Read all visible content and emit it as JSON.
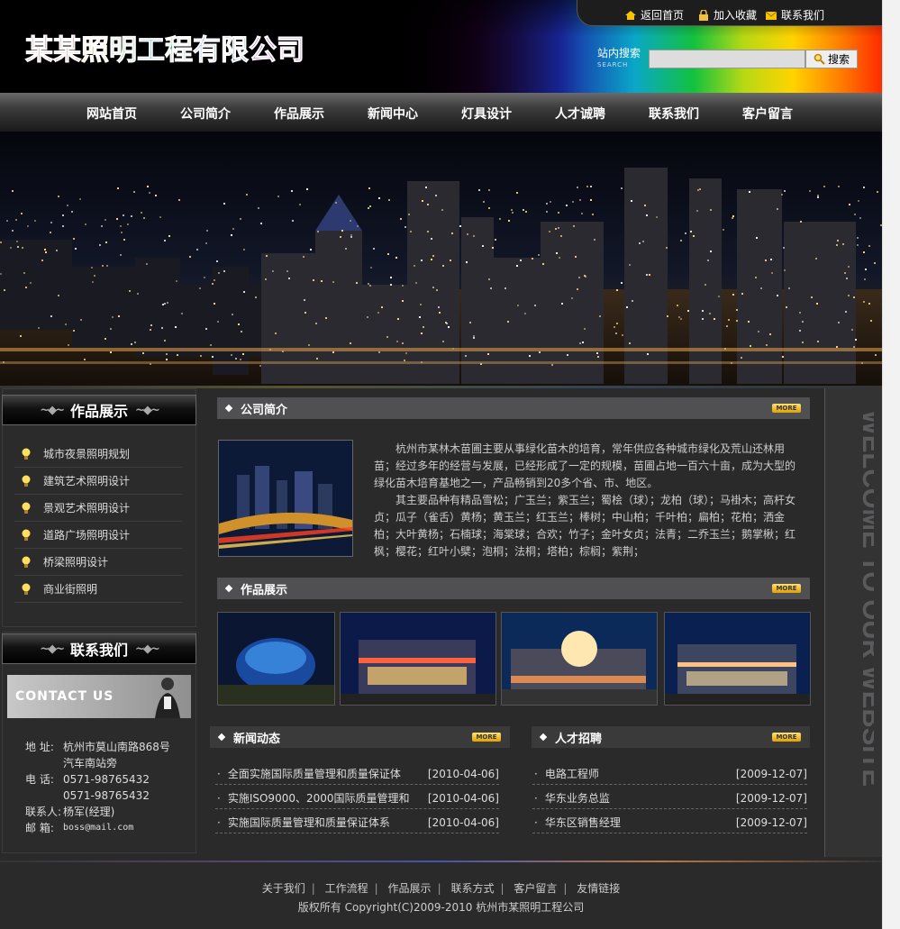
{
  "header": {
    "logo_chars": [
      {
        "c": "某",
        "color": "#e8262b"
      },
      {
        "c": "某",
        "color": "#e8262b"
      },
      {
        "c": "照",
        "color": "#ffcc00"
      },
      {
        "c": "明",
        "color": "#2bb04a"
      },
      {
        "c": "工",
        "color": "#29a9e0"
      },
      {
        "c": "程",
        "color": "#2bb04a"
      },
      {
        "c": "有",
        "color": "#1f4fd8"
      },
      {
        "c": "限",
        "color": "#1f4fd8"
      },
      {
        "c": "公",
        "color": "#a11fd8"
      },
      {
        "c": "司",
        "color": "#a11fd8"
      }
    ],
    "top_links": [
      "返回首页",
      "加入收藏",
      "联系我们"
    ],
    "search_label": "站内搜索",
    "search_label_en": "SEARCH",
    "search_value": "",
    "search_button": "搜索"
  },
  "nav": [
    "网站首页",
    "公司简介",
    "作品展示",
    "新闻中心",
    "灯具设计",
    "人才诚聘",
    "联系我们",
    "客户留言"
  ],
  "left": {
    "works_title": "作品展示",
    "works_items": [
      "城市夜景照明规划",
      "建筑艺术照明设计",
      "景观艺术照明设计",
      "道路广场照明设计",
      "桥梁照明设计",
      "商业街照明"
    ],
    "contact_title": "联系我们",
    "contact_banner": "CONTACT US",
    "contact": [
      {
        "k": "地 址:",
        "v": "杭州市莫山南路868号"
      },
      {
        "k": "",
        "v": "汽车南站旁"
      },
      {
        "k": "电 话:",
        "v": "0571-98765432"
      },
      {
        "k": "",
        "v": "0571-98765432"
      },
      {
        "k": "联系人:",
        "v": "杨军(经理)"
      },
      {
        "k": "邮 箱:",
        "v": "boss@mail.com"
      }
    ]
  },
  "center": {
    "intro_title": "公司简介",
    "more": "MORE",
    "intro_p1": "杭州市某林木苗圃主要从事绿化苗木的培育，常年供应各种城市绿化及荒山还林用苗；经过多年的经营与发展，已经形成了一定的规模，苗圃占地一百六十亩，成为大型的绿化苗木培育基地之一，产品畅销到20多个省、市、地区。",
    "intro_p2": "其主要品种有精品雪松；广玉兰；紫玉兰；蜀桧（球）；龙柏（球）；马褂木；高杆女贞；瓜子（雀舌）黄杨；黄玉兰；红玉兰；棒树；中山柏；千叶柏；扁柏；花柏；洒金柏；大叶黄杨；石楠球；海棠球；合欢；竹子；金叶女贞；法青；二乔玉兰；鹅掌楸；红枫；樱花；红叶小檗；泡桐；法桐；塔柏；棕榈；紫荆；",
    "works_title": "作品展示",
    "news_title": "新闻动态",
    "news": [
      {
        "t": "全面实施国际质量管理和质量保证体",
        "d": "[2010-04-06]"
      },
      {
        "t": "实施ISO9000、2000国际质量管理和",
        "d": "[2010-04-06]"
      },
      {
        "t": "实施国际质量管理和质量保证体系",
        "d": "[2010-04-06]"
      }
    ],
    "jobs_title": "人才招聘",
    "jobs": [
      {
        "t": "电路工程师",
        "d": "[2009-12-07]"
      },
      {
        "t": "华东业务总监",
        "d": "[2009-12-07]"
      },
      {
        "t": "华东区销售经理",
        "d": "[2009-12-07]"
      }
    ]
  },
  "welcome": "WELCOME TO OUR WEBSITE",
  "footer": {
    "links": [
      "关于我们",
      "工作流程",
      "作品展示",
      "联系方式",
      "客户留言",
      "友情链接"
    ],
    "copyright": "版权所有  Copyright(C)2009-2010 杭州市某照明工程公司"
  }
}
